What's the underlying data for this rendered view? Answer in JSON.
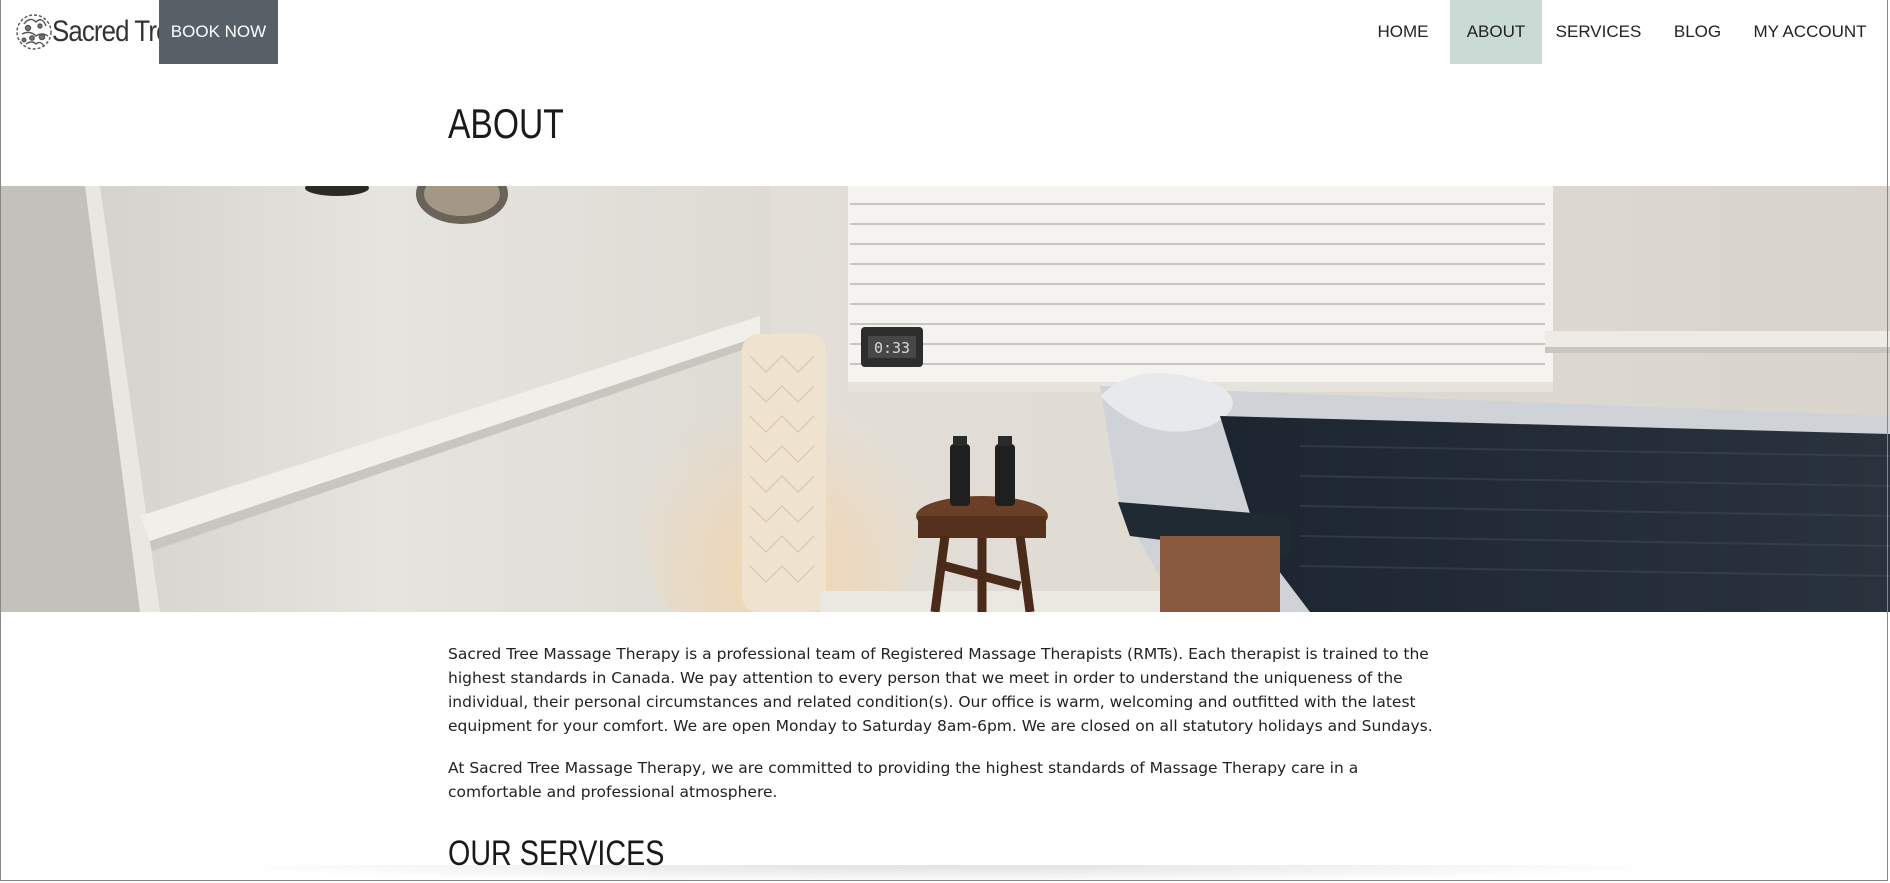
{
  "header": {
    "logo_text": "Sacred Tree",
    "book_label": "BOOK NOW",
    "nav": [
      {
        "label": "HOME"
      },
      {
        "label": "ABOUT"
      },
      {
        "label": "SERVICES"
      },
      {
        "label": "BLOG"
      },
      {
        "label": "MY ACCOUNT"
      }
    ]
  },
  "main": {
    "title": "ABOUT",
    "paragraphs": [
      "Sacred Tree Massage Therapy is a professional team of Registered Massage Therapists (RMTs).  Each therapist is trained to the highest standards in Canada.  We pay attention to every person that we meet in order to understand the uniqueness of the individual, their personal circumstances and related condition(s). Our office is warm, welcoming and outfitted with the latest equipment for your comfort.  We are open Monday to Saturday 8am-6pm. We are closed on all statutory holidays and  Sundays.",
      "At Sacred Tree Massage Therapy, we are committed to providing the highest standards of Massage Therapy care in a comfortable and professional atmosphere."
    ],
    "section_title": "OUR SERVICES"
  },
  "hero": {
    "clock_text": "0:33"
  },
  "colors": {
    "book_button": "#566066",
    "nav_active": "#c9dbd4"
  }
}
